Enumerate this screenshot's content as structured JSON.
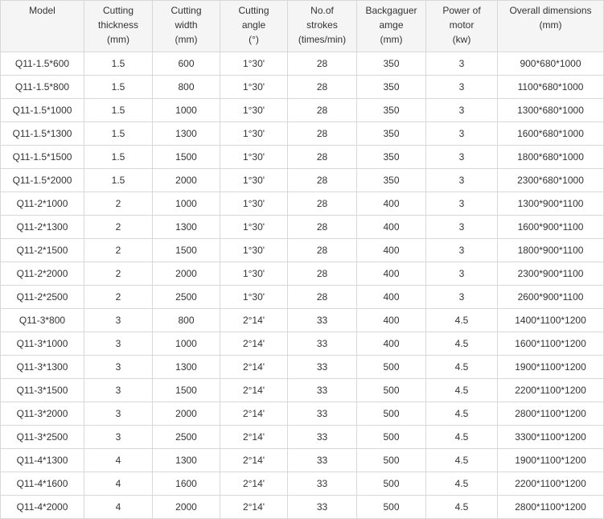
{
  "table": {
    "headers": [
      [
        "Model"
      ],
      [
        "Cutting",
        "thickness",
        "(mm)"
      ],
      [
        "Cutting",
        "width",
        "(mm)"
      ],
      [
        "Cutting",
        "angle",
        "(°)"
      ],
      [
        "No.of",
        "strokes",
        "(times/min)"
      ],
      [
        "Backgaguer",
        "amge",
        "(mm)"
      ],
      [
        "Power of",
        "motor",
        "(kw)"
      ],
      [
        "Overall dimensions",
        "(mm)"
      ]
    ],
    "rows": [
      [
        "Q11-1.5*600",
        "1.5",
        "600",
        "1°30'",
        "28",
        "350",
        "3",
        "900*680*1000"
      ],
      [
        "Q11-1.5*800",
        "1.5",
        "800",
        "1°30'",
        "28",
        "350",
        "3",
        "1100*680*1000"
      ],
      [
        "Q11-1.5*1000",
        "1.5",
        "1000",
        "1°30'",
        "28",
        "350",
        "3",
        "1300*680*1000"
      ],
      [
        "Q11-1.5*1300",
        "1.5",
        "1300",
        "1°30'",
        "28",
        "350",
        "3",
        "1600*680*1000"
      ],
      [
        "Q11-1.5*1500",
        "1.5",
        "1500",
        "1°30'",
        "28",
        "350",
        "3",
        "1800*680*1000"
      ],
      [
        "Q11-1.5*2000",
        "1.5",
        "2000",
        "1°30'",
        "28",
        "350",
        "3",
        "2300*680*1000"
      ],
      [
        "Q11-2*1000",
        "2",
        "1000",
        "1°30'",
        "28",
        "400",
        "3",
        "1300*900*1100"
      ],
      [
        "Q11-2*1300",
        "2",
        "1300",
        "1°30'",
        "28",
        "400",
        "3",
        "1600*900*1100"
      ],
      [
        "Q11-2*1500",
        "2",
        "1500",
        "1°30'",
        "28",
        "400",
        "3",
        "1800*900*1100"
      ],
      [
        "Q11-2*2000",
        "2",
        "2000",
        "1°30'",
        "28",
        "400",
        "3",
        "2300*900*1100"
      ],
      [
        "Q11-2*2500",
        "2",
        "2500",
        "1°30'",
        "28",
        "400",
        "3",
        "2600*900*1100"
      ],
      [
        "Q11-3*800",
        "3",
        "800",
        "2°14'",
        "33",
        "400",
        "4.5",
        "1400*1100*1200"
      ],
      [
        "Q11-3*1000",
        "3",
        "1000",
        "2°14'",
        "33",
        "400",
        "4.5",
        "1600*1100*1200"
      ],
      [
        "Q11-3*1300",
        "3",
        "1300",
        "2°14'",
        "33",
        "500",
        "4.5",
        "1900*1100*1200"
      ],
      [
        "Q11-3*1500",
        "3",
        "1500",
        "2°14'",
        "33",
        "500",
        "4.5",
        "2200*1100*1200"
      ],
      [
        "Q11-3*2000",
        "3",
        "2000",
        "2°14'",
        "33",
        "500",
        "4.5",
        "2800*1100*1200"
      ],
      [
        "Q11-3*2500",
        "3",
        "2500",
        "2°14'",
        "33",
        "500",
        "4.5",
        "3300*1100*1200"
      ],
      [
        "Q11-4*1300",
        "4",
        "1300",
        "2°14'",
        "33",
        "500",
        "4.5",
        "1900*1100*1200"
      ],
      [
        "Q11-4*1600",
        "4",
        "1600",
        "2°14'",
        "33",
        "500",
        "4.5",
        "2200*1100*1200"
      ],
      [
        "Q11-4*2000",
        "4",
        "2000",
        "2°14'",
        "33",
        "500",
        "4.5",
        "2800*1100*1200"
      ]
    ]
  }
}
